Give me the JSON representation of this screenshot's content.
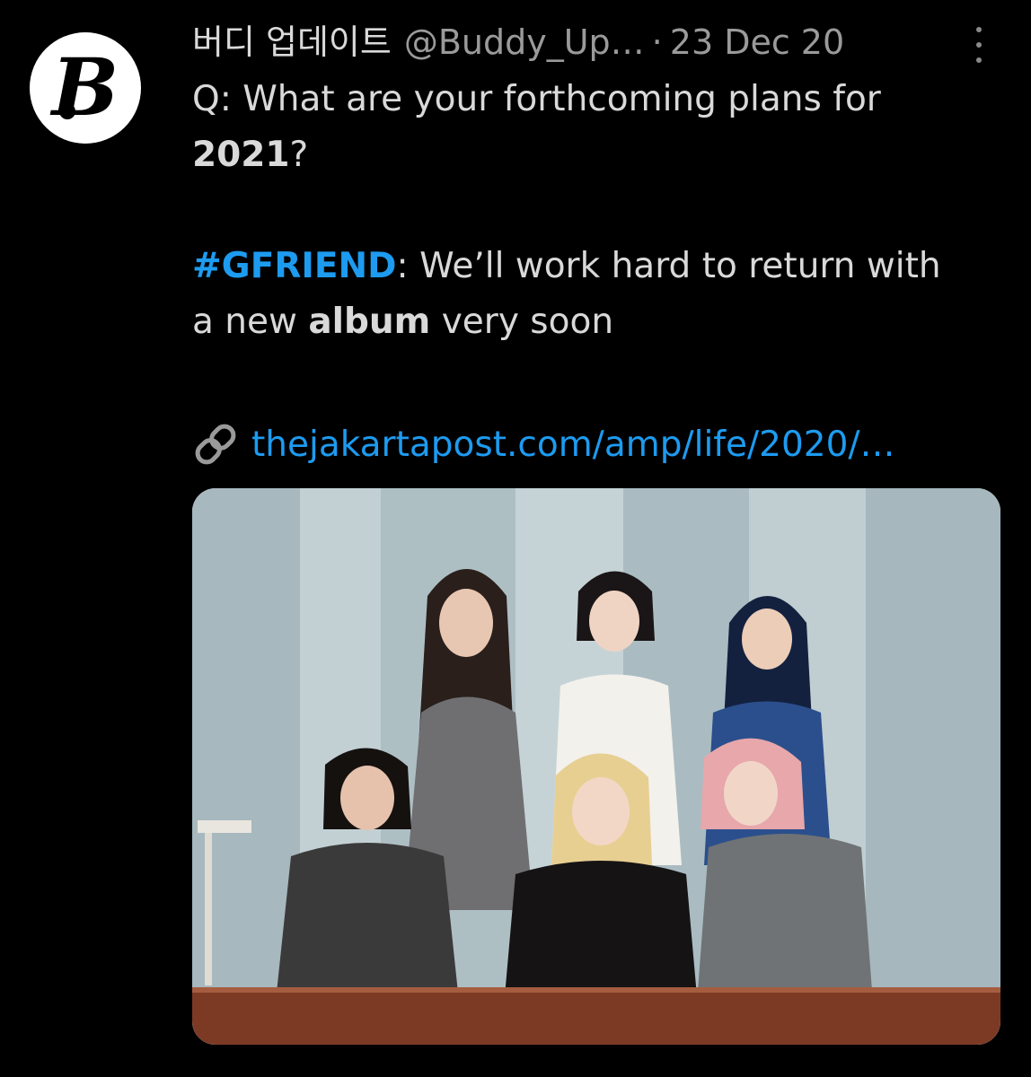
{
  "tweet": {
    "author": {
      "display_name": "버디 업데이트",
      "handle": "@Buddy_Up…",
      "avatar_letter": "B"
    },
    "separator": "·",
    "timestamp": "23 Dec 20",
    "text": {
      "q_prefix": "Q: What are your forthcoming plans for",
      "year": "2021",
      "q_suffix": "?",
      "hashtag": "#GFRIEND",
      "answer_rest": ": We’ll work hard to return with",
      "answer_line2_prefix": "a new ",
      "answer_bold": "album",
      "answer_line2_suffix": " very soon"
    },
    "link": {
      "icon": "link-icon",
      "text": "thejakartapost.com/amp/life/2020/…"
    },
    "media": {
      "description_icon": "photo"
    }
  },
  "colors": {
    "background": "#000000",
    "text": "#d9d9d9",
    "muted": "#9a9a9a",
    "accent": "#1d9bf0"
  }
}
